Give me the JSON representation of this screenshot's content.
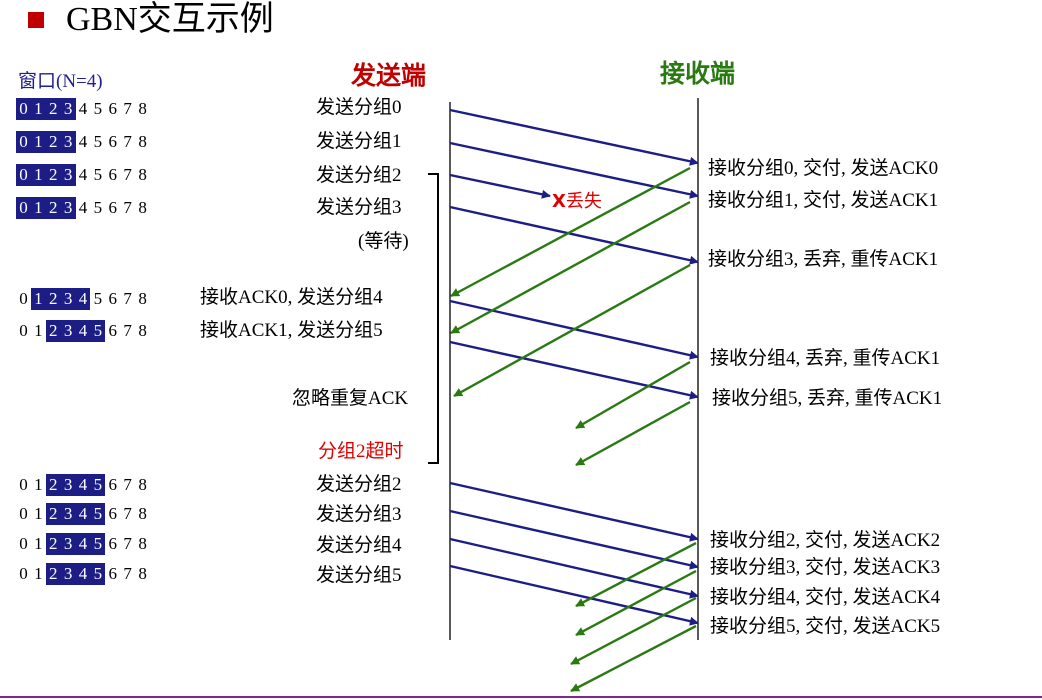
{
  "title": "GBN交互示例",
  "window_label": "窗口(N=4)",
  "headers": {
    "sender": "发送端",
    "receiver": "接收端"
  },
  "window_digits": [
    "0",
    "1",
    "2",
    "3",
    "4",
    "5",
    "6",
    "7",
    "8"
  ],
  "window_rows": [
    {
      "start": 0,
      "size": 4
    },
    {
      "start": 0,
      "size": 4
    },
    {
      "start": 0,
      "size": 4
    },
    {
      "start": 0,
      "size": 4
    },
    {
      "start": 1,
      "size": 4
    },
    {
      "start": 2,
      "size": 4
    },
    {
      "start": 2,
      "size": 4
    },
    {
      "start": 2,
      "size": 4
    },
    {
      "start": 2,
      "size": 4
    },
    {
      "start": 2,
      "size": 4
    }
  ],
  "sender_labels": [
    "发送分组0",
    "发送分组1",
    "发送分组2",
    "发送分组3",
    "(等待)",
    "接收ACK0, 发送分组4",
    "接收ACK1, 发送分组5",
    "忽略重复ACK",
    "分组2超时",
    "发送分组2",
    "发送分组3",
    "发送分组4",
    "发送分组5"
  ],
  "receiver_labels": [
    "接收分组0, 交付, 发送ACK0",
    "接收分组1, 交付, 发送ACK1",
    "接收分组3, 丢弃, 重传ACK1",
    "接收分组4, 丢弃, 重传ACK1",
    "接收分组5, 丢弃, 重传ACK1",
    "接收分组2, 交付, 发送ACK2",
    "接收分组3, 交付, 发送ACK3",
    "接收分组4, 交付, 发送ACK4",
    "接收分组5, 交付, 发送ACK5"
  ],
  "loss": {
    "mark": "X",
    "label": "丢失"
  },
  "colors": {
    "packet": "#1d1d86",
    "ack": "#2a7a12",
    "timeout": "#e00000",
    "window_fill": "#1d1d86"
  }
}
